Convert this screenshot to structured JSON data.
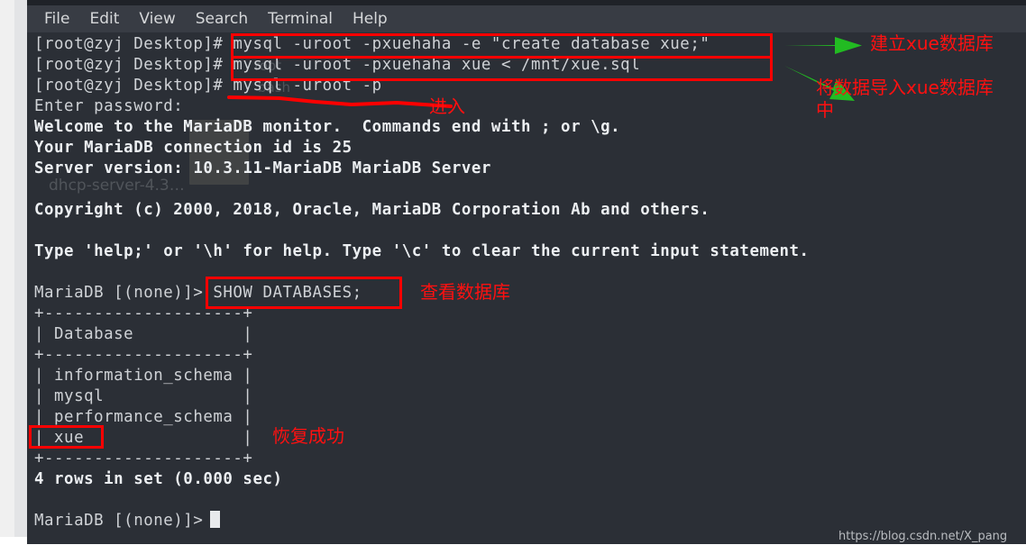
{
  "window": {
    "title": "Terminal"
  },
  "menubar": {
    "items": [
      {
        "label": "File",
        "name": "menu-file"
      },
      {
        "label": "Edit",
        "name": "menu-edit"
      },
      {
        "label": "View",
        "name": "menu-view"
      },
      {
        "label": "Search",
        "name": "menu-search"
      },
      {
        "label": "Terminal",
        "name": "menu-terminal"
      },
      {
        "label": "Help",
        "name": "menu-help"
      }
    ]
  },
  "terminal": {
    "prompt_shell": "[root@zyj Desktop]#",
    "prompt_mariadb": "MariaDB [(none)]>",
    "lines": [
      {
        "id": "l1",
        "text": "[root@zyj Desktop]# mysql -uroot -pxuehaha -e \"create database xue;\"",
        "bold": false
      },
      {
        "id": "l2",
        "text": "[root@zyj Desktop]# mysql -uroot -pxuehaha xue < /mnt/xue.sql",
        "bold": false
      },
      {
        "id": "l3",
        "text": "[root@zyj Desktop]# mysql -uroot -p",
        "bold": false
      },
      {
        "id": "l4",
        "text": "Enter password:",
        "bold": false
      },
      {
        "id": "l5",
        "text": "Welcome to the MariaDB monitor.  Commands end with ; or \\g.",
        "bold": true
      },
      {
        "id": "l6",
        "text": "Your MariaDB connection id is 25",
        "bold": true
      },
      {
        "id": "l7",
        "text": "Server version: 10.3.11-MariaDB MariaDB Server",
        "bold": true
      },
      {
        "id": "l8",
        "text": "",
        "bold": false
      },
      {
        "id": "l9",
        "text": "Copyright (c) 2000, 2018, Oracle, MariaDB Corporation Ab and others.",
        "bold": true
      },
      {
        "id": "l10",
        "text": "",
        "bold": false
      },
      {
        "id": "l11",
        "text": "Type 'help;' or '\\h' for help. Type '\\c' to clear the current input statement.",
        "bold": true
      },
      {
        "id": "l12",
        "text": "",
        "bold": false
      },
      {
        "id": "l13",
        "text": "MariaDB [(none)]> SHOW DATABASES;",
        "bold": false
      },
      {
        "id": "l14",
        "text": "+--------------------+",
        "bold": false
      },
      {
        "id": "l15",
        "text": "| Database           |",
        "bold": false
      },
      {
        "id": "l16",
        "text": "+--------------------+",
        "bold": false
      },
      {
        "id": "l17",
        "text": "| information_schema |",
        "bold": false
      },
      {
        "id": "l18",
        "text": "| mysql              |",
        "bold": false
      },
      {
        "id": "l19",
        "text": "| performance_schema |",
        "bold": false
      },
      {
        "id": "l20",
        "text": "| xue                |",
        "bold": false
      },
      {
        "id": "l21",
        "text": "+--------------------+",
        "bold": false
      },
      {
        "id": "l22",
        "text": "4 rows in set (0.000 sec)",
        "bold": true
      },
      {
        "id": "l23",
        "text": "",
        "bold": false
      },
      {
        "id": "l24",
        "text": "MariaDB [(none)]>",
        "bold": false
      }
    ],
    "ghost_text": "dhcp-server-4.3…",
    "databases": [
      "information_schema",
      "mysql",
      "performance_schema",
      "xue"
    ],
    "row_count_text": "4 rows in set (0.000 sec)",
    "server_version": "10.3.11-MariaDB MariaDB Server",
    "connection_id": "25"
  },
  "annotations": {
    "note_create_db": "建立xue数据库",
    "note_import_db": "将数据导入xue数据库\n中",
    "note_enter": "进入",
    "note_show_db": "查看数据库",
    "note_restore_ok": "恢复成功",
    "accent_red": "#ff0000",
    "accent_green": "#22bb22"
  },
  "watermark": {
    "url": "https://blog.csdn.net/X_pang"
  }
}
